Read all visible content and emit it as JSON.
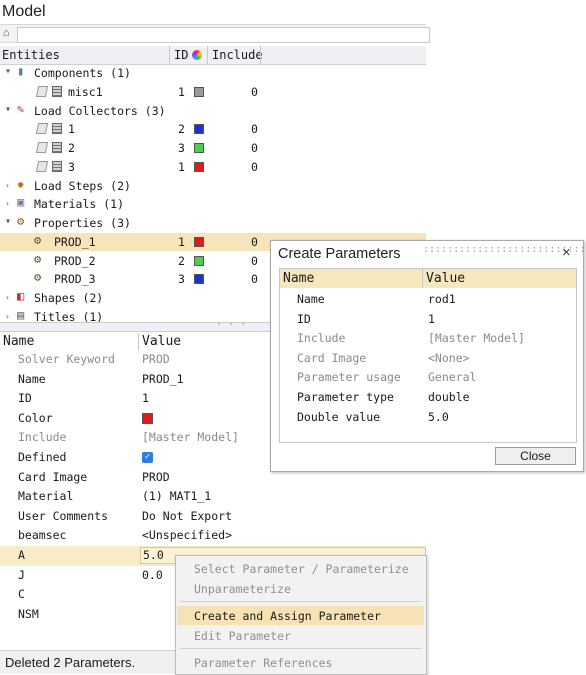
{
  "model": {
    "title": "Model",
    "search_placeholder": "",
    "columns": {
      "entities": "Entities",
      "id": "ID",
      "include": "Include"
    },
    "tree": [
      {
        "label": "Components (1)",
        "expanded": true,
        "icon": "component-icon",
        "level": 0
      },
      {
        "label": "misc1",
        "id": "1",
        "color": "#9b9b9b",
        "include": "0",
        "level": 1
      },
      {
        "label": "Load Collectors (3)",
        "expanded": true,
        "icon": "load-collector-icon",
        "level": 0
      },
      {
        "label": "1",
        "id": "2",
        "color": "#1f2fd6",
        "include": "0",
        "level": 1
      },
      {
        "label": "2",
        "id": "3",
        "color": "#49d14b",
        "include": "0",
        "level": 1
      },
      {
        "label": "3",
        "id": "1",
        "color": "#e21a1a",
        "include": "0",
        "level": 1
      },
      {
        "label": "Load Steps (2)",
        "expanded": false,
        "icon": "load-step-icon",
        "level": 0
      },
      {
        "label": "Materials (1)",
        "expanded": false,
        "icon": "material-icon",
        "level": 0
      },
      {
        "label": "Properties (3)",
        "expanded": true,
        "icon": "property-icon",
        "level": 0
      },
      {
        "label": "PROD_1",
        "id": "1",
        "color": "#e21a1a",
        "include": "0",
        "level": 1,
        "selected": true
      },
      {
        "label": "PROD_2",
        "id": "2",
        "color": "#49d14b",
        "include": "0",
        "level": 1
      },
      {
        "label": "PROD_3",
        "id": "3",
        "color": "#1f2fd6",
        "include": "0",
        "level": 1
      },
      {
        "label": "Shapes (2)",
        "expanded": false,
        "icon": "shape-icon",
        "level": 0
      },
      {
        "label": "Titles (1)",
        "expanded": false,
        "icon": "title-icon",
        "level": 0
      }
    ]
  },
  "properties": {
    "columns": {
      "name": "Name",
      "value": "Value"
    },
    "rows": [
      {
        "name": "Solver Keyword",
        "value": "PROD",
        "grey": true
      },
      {
        "name": "Name",
        "value": "PROD_1"
      },
      {
        "name": "ID",
        "value": "1"
      },
      {
        "name": "Color",
        "value": "",
        "swatch": "#e21a1a"
      },
      {
        "name": "Include",
        "value": "[Master Model]",
        "grey": true
      },
      {
        "name": "Defined",
        "value": "",
        "checkbox": true
      },
      {
        "name": "Card Image",
        "value": "PROD"
      },
      {
        "name": "Material",
        "value": "(1) MAT1_1"
      },
      {
        "name": "User Comments",
        "value": "Do Not Export"
      },
      {
        "name": "beamsec",
        "value": "<Unspecified>"
      },
      {
        "name": "A",
        "value": "5.0",
        "active": true
      },
      {
        "name": "J",
        "value": "0.0"
      },
      {
        "name": "C",
        "value": ""
      },
      {
        "name": "NSM",
        "value": ""
      }
    ]
  },
  "status": {
    "text": "Deleted 2 Parameters."
  },
  "dialog": {
    "title": "Create Parameters",
    "close_symbol": "×",
    "columns": {
      "name": "Name",
      "value": "Value"
    },
    "rows": [
      {
        "name": "Name",
        "value": "rod1"
      },
      {
        "name": "ID",
        "value": "1"
      },
      {
        "name": "Include",
        "value": "[Master Model]",
        "grey": true
      },
      {
        "name": "Card Image",
        "value": "<None>",
        "grey": true
      },
      {
        "name": "Parameter usage",
        "value": "General",
        "grey": true
      },
      {
        "name": "Parameter type",
        "value": "double"
      },
      {
        "name": "Double value",
        "value": "5.0"
      }
    ],
    "close_button": "Close"
  },
  "context_menu": {
    "items": [
      {
        "label": "Select Parameter / Parameterize",
        "disabled": true
      },
      {
        "label": "Unparameterize",
        "disabled": true
      },
      {
        "separator": true
      },
      {
        "label": "Create and Assign Parameter",
        "highlighted": true
      },
      {
        "label": "Edit Parameter",
        "disabled": true
      },
      {
        "separator": true
      },
      {
        "label": "Parameter References",
        "disabled": true
      }
    ]
  }
}
